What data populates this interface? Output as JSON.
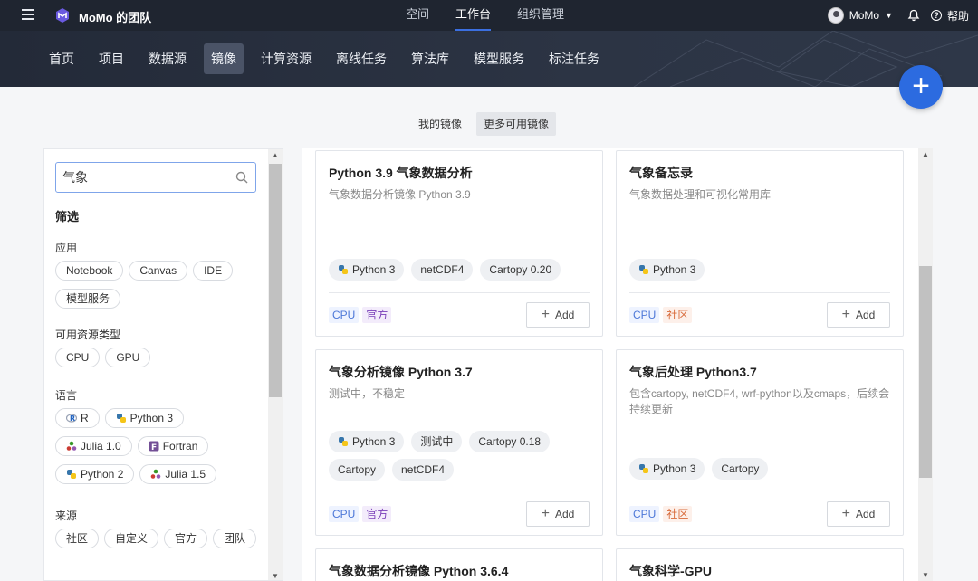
{
  "topbar": {
    "team_name": "MoMo 的团队",
    "tabs": [
      {
        "label": "空间",
        "active": false
      },
      {
        "label": "工作台",
        "active": true
      },
      {
        "label": "组织管理",
        "active": false
      }
    ],
    "user_name": "MoMo",
    "help_label": "帮助",
    "help_symbol": "?"
  },
  "subnav": {
    "items": [
      {
        "label": "首页",
        "active": false
      },
      {
        "label": "项目",
        "active": false
      },
      {
        "label": "数据源",
        "active": false
      },
      {
        "label": "镜像",
        "active": true
      },
      {
        "label": "计算资源",
        "active": false
      },
      {
        "label": "离线任务",
        "active": false
      },
      {
        "label": "算法库",
        "active": false
      },
      {
        "label": "模型服务",
        "active": false
      },
      {
        "label": "标注任务",
        "active": false
      }
    ],
    "fab_label": "+"
  },
  "image_tabs": [
    {
      "label": "我的镜像",
      "active": false
    },
    {
      "label": "更多可用镜像",
      "active": true
    }
  ],
  "sidebar": {
    "search_value": "气象",
    "filter_title": "筛选",
    "groups": [
      {
        "title": "应用",
        "chips": [
          {
            "label": "Notebook"
          },
          {
            "label": "Canvas"
          },
          {
            "label": "IDE"
          },
          {
            "label": "模型服务"
          }
        ]
      },
      {
        "title": "可用资源类型",
        "chips": [
          {
            "label": "CPU"
          },
          {
            "label": "GPU"
          }
        ]
      },
      {
        "title": "语言",
        "chips": [
          {
            "label": "R",
            "icon": "r-lang-icon"
          },
          {
            "label": "Python 3",
            "icon": "python-icon"
          },
          {
            "label": "Julia 1.0",
            "icon": "julia-icon"
          },
          {
            "label": "Fortran",
            "icon": "fortran-icon"
          },
          {
            "label": "Python 2",
            "icon": "python-icon"
          },
          {
            "label": "Julia 1.5",
            "icon": "julia-icon"
          }
        ]
      },
      {
        "title": "来源",
        "chips": [
          {
            "label": "社区"
          },
          {
            "label": "自定义"
          },
          {
            "label": "官方"
          },
          {
            "label": "团队"
          }
        ]
      }
    ]
  },
  "cards": [
    {
      "title": "Python 3.9 气象数据分析",
      "desc": "气象数据分析镜像 Python 3.9",
      "tags": [
        {
          "label": "Python 3",
          "icon": "python-icon"
        },
        {
          "label": "netCDF4"
        },
        {
          "label": "Cartopy 0.20"
        }
      ],
      "resource": "CPU",
      "source": "官方",
      "source_type": "official",
      "add_label": "Add"
    },
    {
      "title": "气象备忘录",
      "desc": "气象数据处理和可视化常用库",
      "tags": [
        {
          "label": "Python 3",
          "icon": "python-icon"
        }
      ],
      "resource": "CPU",
      "source": "社区",
      "source_type": "community",
      "add_label": "Add"
    },
    {
      "title": "气象分析镜像 Python 3.7",
      "desc": "测试中，不稳定",
      "tags": [
        {
          "label": "Python 3",
          "icon": "python-icon"
        },
        {
          "label": "测试中"
        },
        {
          "label": "Cartopy 0.18"
        },
        {
          "label": "Cartopy"
        },
        {
          "label": "netCDF4"
        }
      ],
      "resource": "CPU",
      "source": "官方",
      "source_type": "official",
      "add_label": "Add"
    },
    {
      "title": "气象后处理 Python3.7",
      "desc": "包含cartopy, netCDF4, wrf-python以及cmaps，后续会持续更新",
      "tags": [
        {
          "label": "Python 3",
          "icon": "python-icon"
        },
        {
          "label": "Cartopy"
        }
      ],
      "resource": "CPU",
      "source": "社区",
      "source_type": "community",
      "add_label": "Add"
    },
    {
      "title": "气象数据分析镜像 Python 3.6.4"
    },
    {
      "title": "气象科学-GPU"
    }
  ],
  "colors": {
    "topbar_bg": "#1f2530",
    "accent": "#2c6be0",
    "cpu_badge": "#4d78d8",
    "official_badge": "#7a3fb9",
    "community_badge": "#d86a3a"
  }
}
